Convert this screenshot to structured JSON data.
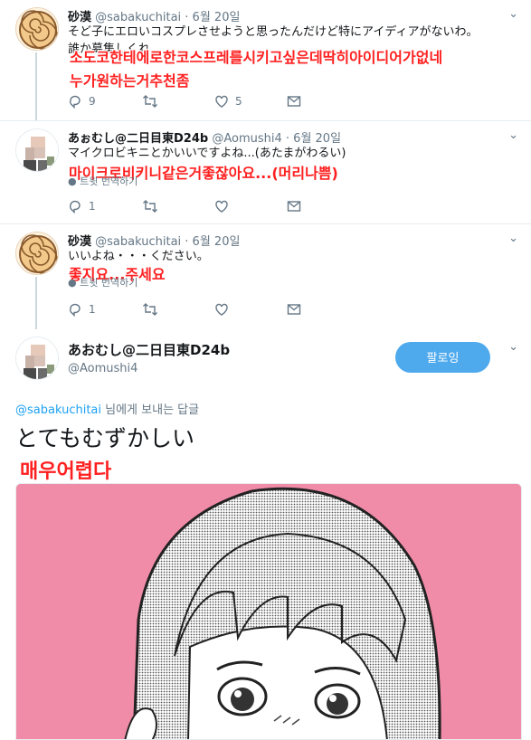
{
  "tweets": [
    {
      "name": "砂漠",
      "handle": "@sabakuchitai",
      "date": "· 6월 20일",
      "text_line1": "そど子にエロいコスプレさせようと思ったんだけど特にアイディアがないわ。",
      "text_line2": "誰か募集しくれ",
      "overlay_line1": "소도코한테에로한코스프레를시키고싶은데딱히아이디어가없네",
      "overlay_line2": "누가원하는거추천좀",
      "reply_count": "9",
      "retweet_count": "",
      "like_count": "5"
    },
    {
      "name": "あぉむし@二日目東D24b",
      "handle": "@Aomushi4",
      "date": "· 6월 20일",
      "text_line1": "マイクロビキニとかいいですよね...(あたまがわるい)",
      "overlay_line1": "마이크로비키니같은거좋잖아요...(머리나쁨)",
      "show_thread": "트윗 번역하기",
      "reply_count": "1",
      "retweet_count": "",
      "like_count": ""
    },
    {
      "name": "砂漠",
      "handle": "@sabakuchitai",
      "date": "· 6월 20일",
      "text_line1": "いいよね・・・ください。",
      "overlay_line1": "좋지요...주세요",
      "show_thread": "트윗 번역하기",
      "reply_count": "1",
      "retweet_count": "",
      "like_count": ""
    }
  ],
  "main_tweet": {
    "name": "あおむし@二日目東D24b",
    "handle": "@Aomushi4",
    "follow_label": "팔로잉",
    "reply_to_handle": "@sabakuchitai",
    "reply_to_suffix": " 님에게 보내는 답글",
    "text": "とてもむずかしい",
    "overlay": "매우어렵다"
  },
  "icons": {
    "reply": "reply-icon",
    "retweet": "retweet-icon",
    "like": "heart-icon",
    "dm": "envelope-icon",
    "more": "chevron-down-icon"
  },
  "colors": {
    "accent": "#1da1f2",
    "overlay_red": "#ff2020",
    "media_bg": "#f08ca8"
  }
}
